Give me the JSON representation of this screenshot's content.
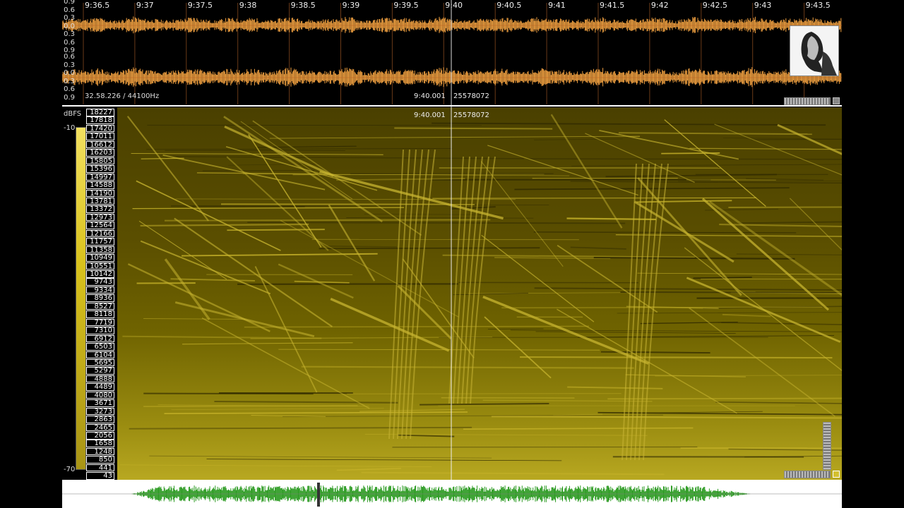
{
  "waveform": {
    "time_labels": [
      "9:36.5",
      "9:37",
      "9:37.5",
      "9:38",
      "9:38.5",
      "9:39",
      "9:39.5",
      "9:40",
      "9:40.5",
      "9:41",
      "9:41.5",
      "9:42",
      "9:42.5",
      "9:43",
      "9:43.5"
    ],
    "amp_labels_top": [
      "0.9",
      "0.6",
      "0.3",
      "0.0",
      "0.3",
      "0.6",
      "0.9"
    ],
    "amp_labels_bottom": [
      "0.6",
      "0.3",
      "0.0",
      "0.3",
      "0.6",
      "0.9"
    ],
    "position_info": "32.58.226 / 44100Hz",
    "cursor_time": "9:40.001",
    "cursor_sample": "25578072",
    "wave_color": "#f0a040"
  },
  "spectrogram": {
    "dbfs_label": "dBFS",
    "db_top": "-10",
    "db_bottom": "-70",
    "cursor_time": "9:40.001",
    "cursor_sample": "25578072",
    "frequencies": [
      "18227",
      "17818",
      "17420",
      "17011",
      "16612",
      "16203",
      "15805",
      "15396",
      "14997",
      "14588",
      "14190",
      "13781",
      "13372",
      "12973",
      "12564",
      "12166",
      "11757",
      "11358",
      "10949",
      "10551",
      "10142",
      "9743",
      "9334",
      "8936",
      "8527",
      "8118",
      "7719",
      "7310",
      "6912",
      "6503",
      "6104",
      "5695",
      "5297",
      "4888",
      "4489",
      "4080",
      "3671",
      "3273",
      "2863",
      "2465",
      "2056",
      "1658",
      "1248",
      "850",
      "441",
      "43"
    ],
    "color": "#b8a821"
  },
  "overview": {
    "wave_color": "#2a9a20"
  }
}
